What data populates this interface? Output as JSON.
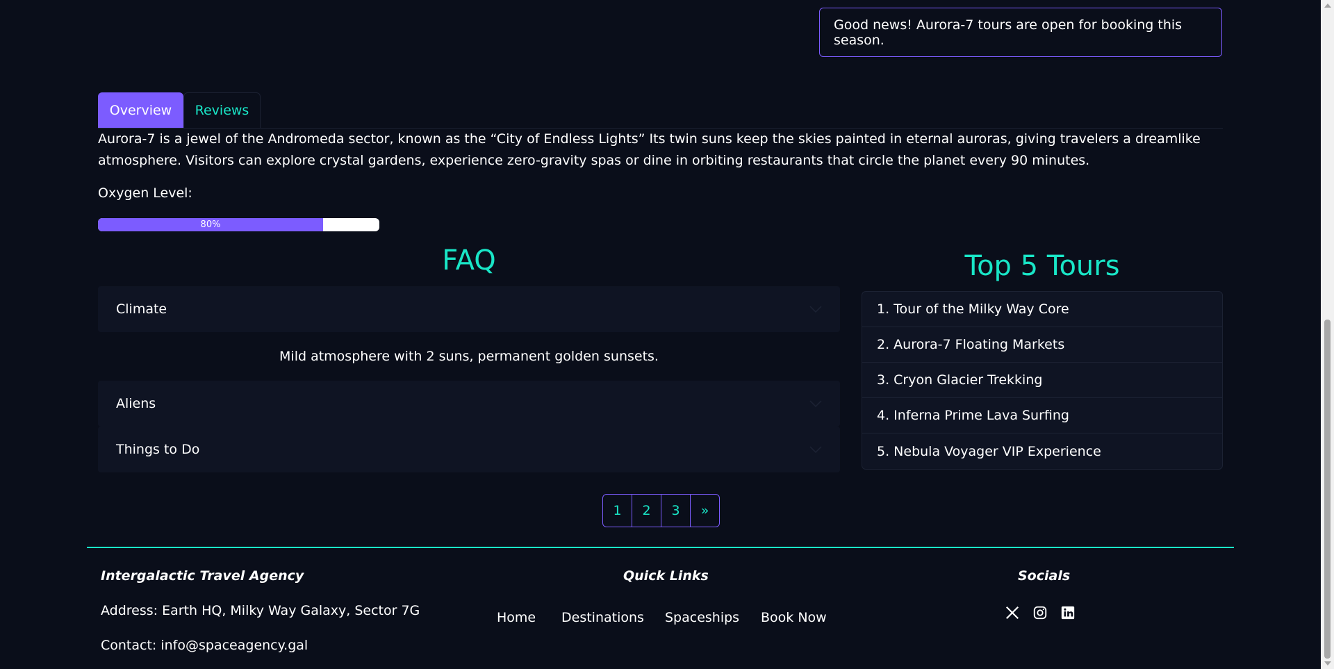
{
  "alert": {
    "text": "Good news! Aurora-7 tours are open for booking this season."
  },
  "tabs": [
    {
      "label": "Overview",
      "active": true
    },
    {
      "label": "Reviews",
      "active": false
    }
  ],
  "overview": {
    "description": "Aurora-7 is a jewel of the Andromeda sector, known as the “City of Endless Lights” Its twin suns keep the skies painted in eternal auroras, giving travelers a dreamlike atmosphere. Visitors can explore crystal gardens, experience zero-gravity spas or dine in orbiting restaurants that circle the planet every 90 minutes.",
    "oxygen_label": "Oxygen Level:",
    "oxygen_value": 80,
    "oxygen_text": "80%"
  },
  "faq": {
    "title": "FAQ",
    "items": [
      {
        "question": "Climate",
        "answer": "Mild atmosphere with 2 suns, permanent golden sunsets.",
        "expanded": true
      },
      {
        "question": "Aliens",
        "expanded": false
      },
      {
        "question": "Things to Do",
        "expanded": false
      }
    ]
  },
  "tours": {
    "title": "Top 5 Tours",
    "items": [
      "1. Tour of the Milky Way Core",
      "2. Aurora-7 Floating Markets",
      "3. Cryon Glacier Trekking",
      "4. Inferna Prime Lava Surfing",
      "5. Nebula Voyager VIP Experience"
    ]
  },
  "pagination": {
    "pages": [
      "1",
      "2",
      "3"
    ],
    "next": "»"
  },
  "footer": {
    "agency_title": "Intergalactic Travel Agency",
    "address": "Address: Earth HQ, Milky Way Galaxy, Sector 7G",
    "contact": "Contact: info@spaceagency.gal",
    "quick_links_title": "Quick Links",
    "links": [
      "Home",
      "Destinations",
      "Spaceships",
      "Book Now"
    ],
    "socials_title": "Socials",
    "socials": [
      "x-icon",
      "instagram-icon",
      "linkedin-icon"
    ]
  },
  "colors": {
    "background": "#0a0e1a",
    "accent": "#7c5cff",
    "teal": "#19e6c7",
    "panel": "#0f1423"
  }
}
